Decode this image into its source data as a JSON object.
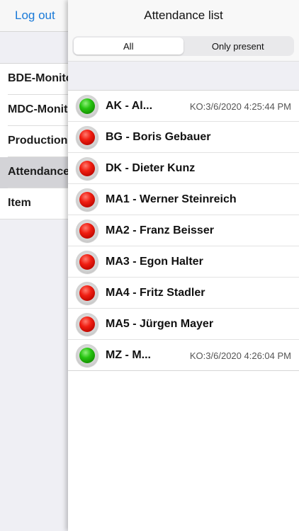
{
  "side_menu": {
    "logout_label": "Log out",
    "items": [
      {
        "label": "BDE-Monitor",
        "selected": false
      },
      {
        "label": "MDC-Monitor",
        "selected": false
      },
      {
        "label": "Production",
        "selected": false
      },
      {
        "label": "Attendance",
        "selected": true
      },
      {
        "label": "Item",
        "selected": false
      }
    ]
  },
  "panel": {
    "title": "Attendance list",
    "filter": {
      "options": [
        "All",
        "Only present"
      ],
      "selected": "All"
    },
    "rows": [
      {
        "name": "AK - Al...",
        "time": "KO:3/6/2020 4:25:44 PM",
        "status": "green",
        "icon": "status-light-green-icon"
      },
      {
        "name": "BG - Boris Gebauer",
        "time": "",
        "status": "red",
        "icon": "status-light-red-icon"
      },
      {
        "name": "DK - Dieter Kunz",
        "time": "",
        "status": "red",
        "icon": "status-light-red-icon"
      },
      {
        "name": "MA1 - Werner Steinreich",
        "time": "",
        "status": "red",
        "icon": "status-light-red-icon"
      },
      {
        "name": "MA2 - Franz Beisser",
        "time": "",
        "status": "red",
        "icon": "status-light-red-icon"
      },
      {
        "name": "MA3 - Egon Halter",
        "time": "",
        "status": "red",
        "icon": "status-light-red-icon"
      },
      {
        "name": "MA4 - Fritz Stadler",
        "time": "",
        "status": "red",
        "icon": "status-light-red-icon"
      },
      {
        "name": "MA5 - Jürgen Mayer",
        "time": "",
        "status": "red",
        "icon": "status-light-red-icon"
      },
      {
        "name": "MZ - M...",
        "time": "KO:3/6/2020 4:26:04 PM",
        "status": "green",
        "icon": "status-light-green-icon"
      }
    ]
  },
  "colors": {
    "accent": "#1a7ad8",
    "present": "#27c411",
    "absent": "#f01e12",
    "selected_row": "#d3d3d7"
  }
}
